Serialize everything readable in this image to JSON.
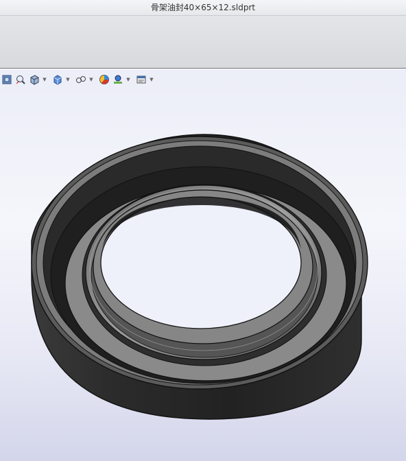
{
  "window": {
    "title": "骨架油封40×65×12.sldprt"
  },
  "hud": {
    "items": [
      {
        "name": "zoom-to-fit-icon"
      },
      {
        "name": "zoom-to-area-icon"
      },
      {
        "name": "section-view-icon"
      },
      {
        "name": "view-orientation-icon"
      },
      {
        "name": "display-style-icon"
      },
      {
        "name": "hide-show-items-icon"
      },
      {
        "name": "edit-appearance-icon"
      },
      {
        "name": "apply-scene-icon"
      },
      {
        "name": "view-settings-icon"
      }
    ]
  },
  "colors": {
    "rubber_dark": "#2a2a2a",
    "rubber_mid": "#4a4a4a",
    "rim_light": "#8c8c8c",
    "viewport_top": "#eceef8",
    "viewport_bottom": "#d3d5ea"
  }
}
